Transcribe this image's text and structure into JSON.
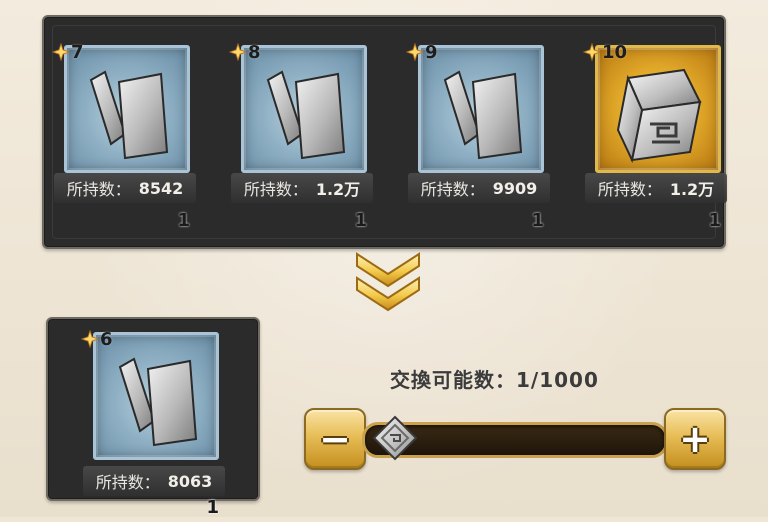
{
  "top_items": [
    {
      "level": "7",
      "quantity": "1",
      "owned_label": "所持数：",
      "owned_value": "8542",
      "frame": "blue"
    },
    {
      "level": "8",
      "quantity": "1",
      "owned_label": "所持数：",
      "owned_value": "1.2万",
      "frame": "blue"
    },
    {
      "level": "9",
      "quantity": "1",
      "owned_label": "所持数：",
      "owned_value": "9909",
      "frame": "blue"
    },
    {
      "level": "10",
      "quantity": "1",
      "owned_label": "所持数：",
      "owned_value": "1.2万",
      "frame": "gold"
    }
  ],
  "result_item": {
    "level": "6",
    "quantity": "1",
    "owned_label": "所持数：",
    "owned_value": "8063",
    "frame": "blue"
  },
  "exchange": {
    "title": "交換可能数：1/1000",
    "current": 1,
    "max": 1000,
    "minus_label": "−",
    "plus_label": "+"
  },
  "icons": {
    "star": "star-icon",
    "arrows": "double-chevron-down-icon",
    "ingot": "silver-ingot-icon"
  },
  "colors": {
    "panel": "#2b2b2b",
    "blue_frame": "#a9c4d6",
    "gold_frame": "#e1b84a",
    "button_gold": "#e7bd57"
  }
}
